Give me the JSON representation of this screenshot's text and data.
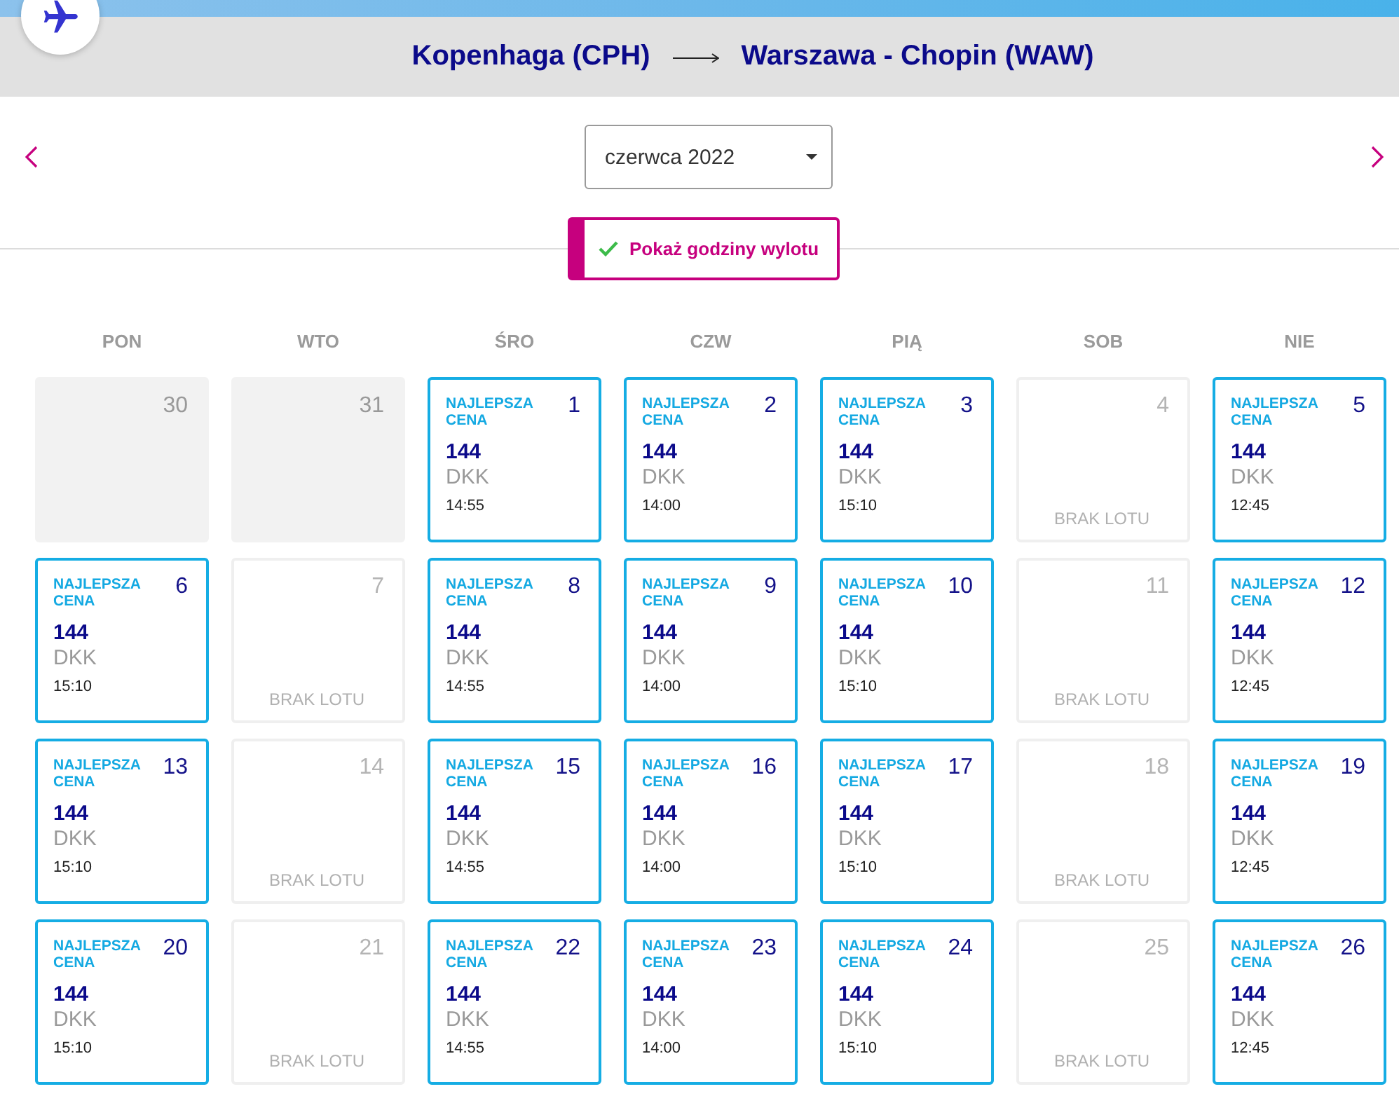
{
  "route": {
    "origin": "Kopenhaga (CPH)",
    "destination": "Warszawa - Chopin (WAW)"
  },
  "month_picker": {
    "value": "czerwca 2022"
  },
  "hours_toggle": {
    "label": "Pokaż godziny wylotu",
    "checked": true
  },
  "calendar": {
    "weekdays": [
      "PON",
      "WTO",
      "ŚRO",
      "CZW",
      "PIĄ",
      "SOB",
      "NIE"
    ],
    "days": [
      {
        "kind": "outside",
        "day": "30"
      },
      {
        "kind": "outside",
        "day": "31"
      },
      {
        "kind": "flight",
        "day": "1",
        "badge": "NAJLEPSZA CENA",
        "price": "144",
        "currency": "DKK",
        "time": "14:55"
      },
      {
        "kind": "flight",
        "day": "2",
        "badge": "NAJLEPSZA CENA",
        "price": "144",
        "currency": "DKK",
        "time": "14:00"
      },
      {
        "kind": "flight",
        "day": "3",
        "badge": "NAJLEPSZA CENA",
        "price": "144",
        "currency": "DKK",
        "time": "15:10"
      },
      {
        "kind": "none",
        "day": "4",
        "note": "BRAK LOTU"
      },
      {
        "kind": "flight",
        "day": "5",
        "badge": "NAJLEPSZA CENA",
        "price": "144",
        "currency": "DKK",
        "time": "12:45"
      },
      {
        "kind": "flight",
        "day": "6",
        "badge": "NAJLEPSZA CENA",
        "price": "144",
        "currency": "DKK",
        "time": "15:10"
      },
      {
        "kind": "none",
        "day": "7",
        "note": "BRAK LOTU"
      },
      {
        "kind": "flight",
        "day": "8",
        "badge": "NAJLEPSZA CENA",
        "price": "144",
        "currency": "DKK",
        "time": "14:55"
      },
      {
        "kind": "flight",
        "day": "9",
        "badge": "NAJLEPSZA CENA",
        "price": "144",
        "currency": "DKK",
        "time": "14:00"
      },
      {
        "kind": "flight",
        "day": "10",
        "badge": "NAJLEPSZA CENA",
        "price": "144",
        "currency": "DKK",
        "time": "15:10"
      },
      {
        "kind": "none",
        "day": "11",
        "note": "BRAK LOTU"
      },
      {
        "kind": "flight",
        "day": "12",
        "badge": "NAJLEPSZA CENA",
        "price": "144",
        "currency": "DKK",
        "time": "12:45"
      },
      {
        "kind": "flight",
        "day": "13",
        "badge": "NAJLEPSZA CENA",
        "price": "144",
        "currency": "DKK",
        "time": "15:10"
      },
      {
        "kind": "none",
        "day": "14",
        "note": "BRAK LOTU"
      },
      {
        "kind": "flight",
        "day": "15",
        "badge": "NAJLEPSZA CENA",
        "price": "144",
        "currency": "DKK",
        "time": "14:55"
      },
      {
        "kind": "flight",
        "day": "16",
        "badge": "NAJLEPSZA CENA",
        "price": "144",
        "currency": "DKK",
        "time": "14:00"
      },
      {
        "kind": "flight",
        "day": "17",
        "badge": "NAJLEPSZA CENA",
        "price": "144",
        "currency": "DKK",
        "time": "15:10"
      },
      {
        "kind": "none",
        "day": "18",
        "note": "BRAK LOTU"
      },
      {
        "kind": "flight",
        "day": "19",
        "badge": "NAJLEPSZA CENA",
        "price": "144",
        "currency": "DKK",
        "time": "12:45"
      },
      {
        "kind": "flight",
        "day": "20",
        "badge": "NAJLEPSZA CENA",
        "price": "144",
        "currency": "DKK",
        "time": "15:10"
      },
      {
        "kind": "none",
        "day": "21",
        "note": "BRAK LOTU"
      },
      {
        "kind": "flight",
        "day": "22",
        "badge": "NAJLEPSZA CENA",
        "price": "144",
        "currency": "DKK",
        "time": "14:55"
      },
      {
        "kind": "flight",
        "day": "23",
        "badge": "NAJLEPSZA CENA",
        "price": "144",
        "currency": "DKK",
        "time": "14:00"
      },
      {
        "kind": "flight",
        "day": "24",
        "badge": "NAJLEPSZA CENA",
        "price": "144",
        "currency": "DKK",
        "time": "15:10"
      },
      {
        "kind": "none",
        "day": "25",
        "note": "BRAK LOTU"
      },
      {
        "kind": "flight",
        "day": "26",
        "badge": "NAJLEPSZA CENA",
        "price": "144",
        "currency": "DKK",
        "time": "12:45"
      }
    ]
  }
}
